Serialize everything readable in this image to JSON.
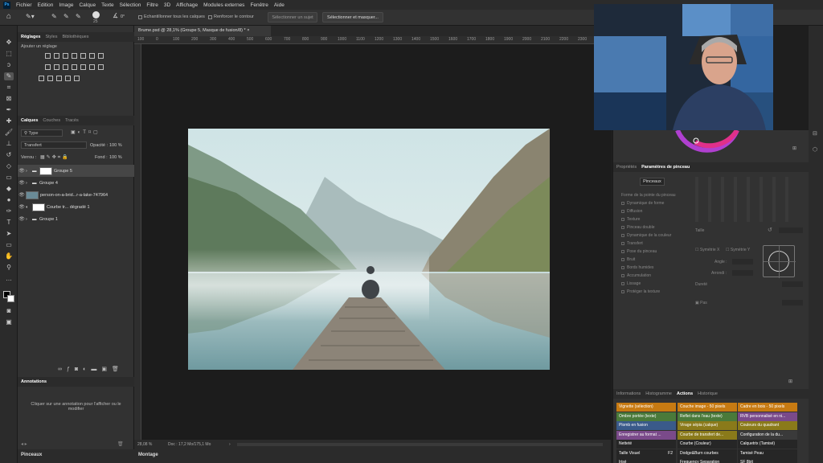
{
  "menu": {
    "logo": "Ps",
    "items": [
      "Fichier",
      "Edition",
      "Image",
      "Calque",
      "Texte",
      "Sélection",
      "Filtre",
      "3D",
      "Affichage",
      "Modules externes",
      "Fenêtre",
      "Aide"
    ]
  },
  "options": {
    "brush_size": "25",
    "angle": "0°",
    "sample_all_layers": "Echantillonner tous les calques",
    "enhance_edge": "Renforcer le contour",
    "select_subject": "Sélectionner un sujet",
    "select_and_mask": "Sélectionner et masquer..."
  },
  "adjustments": {
    "tabs": [
      "Réglages",
      "Styles",
      "Bibliothèques"
    ],
    "add_label": "Ajouter un réglage"
  },
  "layers": {
    "tabs": [
      "Calques",
      "Couches",
      "Tracés"
    ],
    "filter": "Type",
    "blend_mode": "Transfert",
    "opacity_label": "Opacité :",
    "opacity": "100 %",
    "lock_label": "Verrou :",
    "fill_label": "Fond :",
    "fill": "100 %",
    "rows": [
      {
        "name": "Groupe 5"
      },
      {
        "name": "Groupe 4"
      },
      {
        "name": "person-on-a-brid...r-a-lake-747964"
      },
      {
        "name": "Courbe tr... dégradé 1"
      },
      {
        "name": "Groupe 1"
      }
    ]
  },
  "annotations": {
    "title": "Annotations",
    "hint": "Cliquer sur une annotation pour l'afficher ou le modifier"
  },
  "bottom_tabs": {
    "brushes": "Pinceaux",
    "timeline": "Montage"
  },
  "document": {
    "tab": "Brume.psd @ 28,1% (Groupe 5, Masque de fusion/8) *",
    "zoom": "28,08 %",
    "doc_info": "Doc : 17,2 Mo/175,1 Mo",
    "ruler_ticks": [
      "100",
      "0",
      "100",
      "200",
      "300",
      "400",
      "500",
      "600",
      "700",
      "800",
      "900",
      "1000",
      "1100",
      "1200",
      "1300",
      "1400",
      "1500",
      "1600",
      "1700",
      "1800",
      "1900",
      "2000",
      "2100",
      "2200",
      "2300",
      "2400"
    ]
  },
  "brush_settings": {
    "tabs": [
      "Propriétés",
      "Paramètres de pinceau"
    ],
    "button": "Pinceaux",
    "options": [
      "Forme de la pointe du pinceau",
      "Dynamique de forme",
      "Diffusion",
      "Texture",
      "Pinceau double",
      "Dynamique de la couleur",
      "Transfert",
      "Pose du pinceau",
      "Bruit",
      "Bords humides",
      "Accumulation",
      "Lissage",
      "Protéger la texture"
    ],
    "size_label": "Taille",
    "flip_x": "Symétrie X",
    "flip_y": "Symétrie Y",
    "angle_label": "Angle :",
    "roundness_label": "Arrondi :",
    "hardness_label": "Dureté",
    "spacing_label": "Pas"
  },
  "actions": {
    "tabs": [
      "Informations",
      "Histogramme",
      "Actions",
      "Historique"
    ],
    "items": [
      {
        "label": "Vignette (sélection)",
        "color": "#c77a12"
      },
      {
        "label": "Couche image - 50 pixels",
        "color": "#c77a12"
      },
      {
        "label": "Cadre en bois - 50 pixels",
        "color": "#c77a12"
      },
      {
        "label": "Ombre portée (texte)",
        "color": "#4a7a3a"
      },
      {
        "label": "Reflet dans l'eau (texte)",
        "color": "#4a7a3a"
      },
      {
        "label": "RVB personnalisé en ni...",
        "color": "#7a4a8a"
      },
      {
        "label": "Plomb en fusion",
        "color": "#3a5a8a"
      },
      {
        "label": "Virage sépia (calque)",
        "color": "#8a7a1a"
      },
      {
        "label": "Couleurs du quadrant",
        "color": "#8a7a1a"
      },
      {
        "label": "Enregistrer au format ...",
        "color": "#7a4a8a"
      },
      {
        "label": "Courbe de transfert de...",
        "color": "#8a7a1a"
      },
      {
        "label": "Configuration de la du...",
        "color": "#3a3a3a"
      },
      {
        "label": "Netteté",
        "color": "#262626"
      },
      {
        "label": "Courbe (Couleur)",
        "color": "#262626"
      },
      {
        "label": "Calquetrix (Tamisé)",
        "color": "#262626"
      },
      {
        "label": "Taille Visuel",
        "shortcut": "F2",
        "color": "#262626"
      },
      {
        "label": "Dodge&Burn courbes",
        "color": "#262626"
      },
      {
        "label": "Tamisé Peau",
        "color": "#262626"
      },
      {
        "label": "Irisé",
        "color": "#262626"
      },
      {
        "label": "Frequency Separation",
        "color": "#262626"
      },
      {
        "label": "SF 8bit",
        "color": "#262626"
      }
    ]
  }
}
